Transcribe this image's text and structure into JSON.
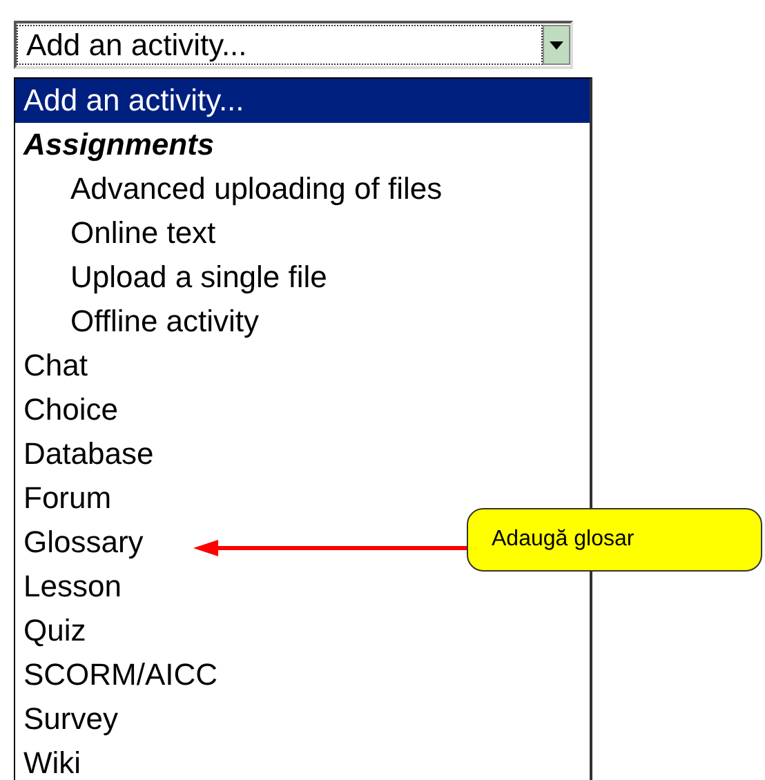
{
  "select": {
    "value": "Add an activity..."
  },
  "options": [
    {
      "label": "Add an activity...",
      "kind": "option",
      "selected": true
    },
    {
      "label": "Assignments",
      "kind": "group",
      "selected": false
    },
    {
      "label": "Advanced uploading of files",
      "kind": "suboption",
      "selected": false
    },
    {
      "label": "Online text",
      "kind": "suboption",
      "selected": false
    },
    {
      "label": "Upload a single file",
      "kind": "suboption",
      "selected": false
    },
    {
      "label": "Offline activity",
      "kind": "suboption",
      "selected": false
    },
    {
      "label": "Chat",
      "kind": "option",
      "selected": false
    },
    {
      "label": "Choice",
      "kind": "option",
      "selected": false
    },
    {
      "label": "Database",
      "kind": "option",
      "selected": false
    },
    {
      "label": "Forum",
      "kind": "option",
      "selected": false
    },
    {
      "label": "Glossary",
      "kind": "option",
      "selected": false
    },
    {
      "label": "Lesson",
      "kind": "option",
      "selected": false
    },
    {
      "label": "Quiz",
      "kind": "option",
      "selected": false
    },
    {
      "label": "SCORM/AICC",
      "kind": "option",
      "selected": false
    },
    {
      "label": "Survey",
      "kind": "option",
      "selected": false
    },
    {
      "label": "Wiki",
      "kind": "option",
      "selected": false
    }
  ],
  "callout": {
    "text": "Adaugă glosar"
  }
}
